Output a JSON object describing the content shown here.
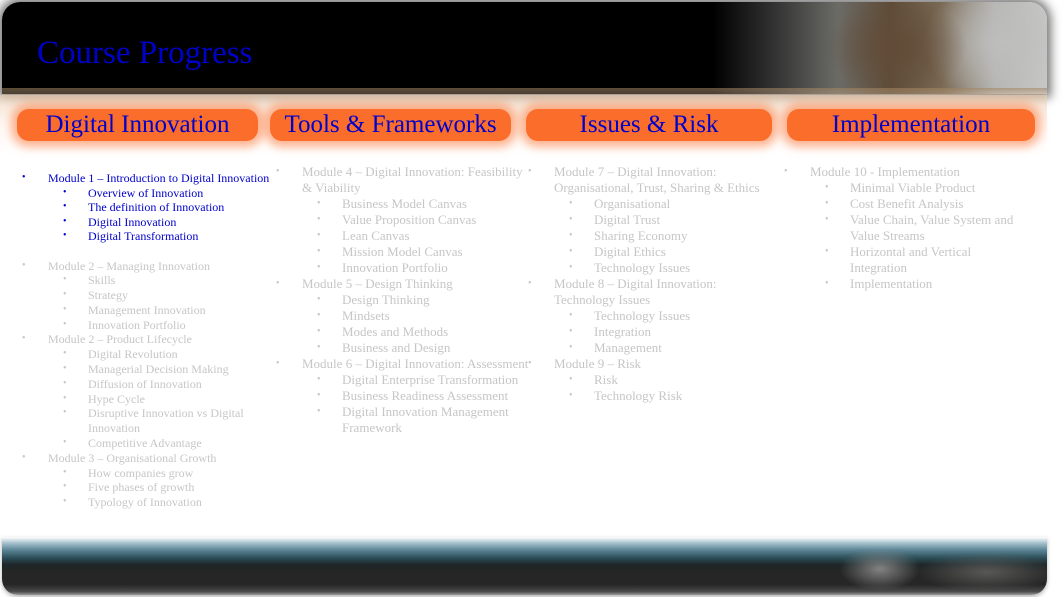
{
  "slide": {
    "title": "Course Progress",
    "colors": {
      "title_text": "#0000cc",
      "category_bar": "#fb6d2a",
      "active_text": "#0000cc",
      "inactive_text": "#c6c6c6"
    },
    "bullet_glyph": "•"
  },
  "categories": [
    {
      "label": "Digital Innovation",
      "modules": [
        {
          "title": "Module 1 – Introduction to Digital Innovation",
          "state": "active",
          "topics": [
            "Overview of Innovation",
            "The definition of Innovation",
            "Digital Innovation",
            "Digital Transformation"
          ]
        },
        {
          "title": "Module 2 – Managing Innovation",
          "state": "inactive",
          "topics": [
            "Skills",
            "Strategy",
            "Management Innovation",
            "Innovation Portfolio"
          ]
        },
        {
          "title": "Module 2 – Product Lifecycle",
          "state": "inactive",
          "topics": [
            "Digital Revolution",
            "Managerial Decision Making",
            "Diffusion of Innovation",
            "Hype Cycle",
            "Disruptive Innovation vs Digital Innovation",
            "Competitive Advantage"
          ]
        },
        {
          "title": "Module 3 – Organisational Growth",
          "state": "inactive",
          "topics": [
            "How companies grow",
            "Five phases of growth",
            "Typology of Innovation"
          ]
        }
      ]
    },
    {
      "label": "Tools & Frameworks",
      "modules": [
        {
          "title": "Module 4 – Digital Innovation: Feasibility & Viability",
          "state": "inactive",
          "topics": [
            "Business Model Canvas",
            "Value Proposition Canvas",
            "Lean Canvas",
            "Mission Model Canvas",
            "Innovation Portfolio"
          ]
        },
        {
          "title": "Module 5 – Design Thinking",
          "state": "inactive",
          "topics": [
            "Design Thinking",
            "Mindsets",
            "Modes and Methods",
            "Business and Design"
          ]
        },
        {
          "title": "Module 6 – Digital Innovation: Assessment",
          "state": "inactive",
          "topics": [
            "Digital Enterprise Transformation",
            "Business Readiness Assessment",
            "Digital Innovation Management Framework"
          ]
        }
      ]
    },
    {
      "label": "Issues & Risk",
      "modules": [
        {
          "title": "Module 7 – Digital Innovation: Organisational, Trust, Sharing & Ethics",
          "state": "inactive",
          "topics": [
            "Organisational",
            "Digital Trust",
            "Sharing Economy",
            "Digital Ethics",
            "Technology Issues"
          ]
        },
        {
          "title": "Module 8 – Digital Innovation: Technology Issues",
          "state": "inactive",
          "topics": [
            "Technology Issues",
            "Integration",
            "Management"
          ]
        },
        {
          "title": "Module 9 – Risk",
          "state": "inactive",
          "topics": [
            "Risk",
            "Technology Risk"
          ]
        }
      ]
    },
    {
      "label": "Implementation",
      "modules": [
        {
          "title": "Module 10 - Implementation",
          "state": "inactive",
          "topics": [
            "Minimal Viable Product",
            "Cost Benefit Analysis",
            "Value Chain, Value System and Value Streams",
            "Horizontal and Vertical Integration",
            "Implementation"
          ]
        }
      ]
    }
  ]
}
